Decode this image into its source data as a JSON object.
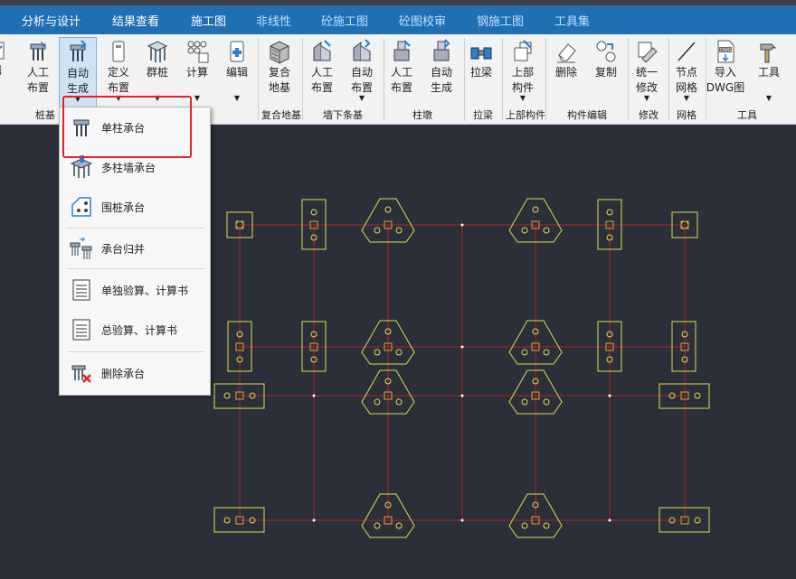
{
  "tabs": [
    "分析与设计",
    "结果查看",
    "施工图",
    "非线性",
    "砼施工图",
    "砼图校审",
    "钢施工图",
    "工具集"
  ],
  "ribbon": {
    "buttons": [
      {
        "label1": "辑",
        "label2": ""
      },
      {
        "label1": "人工",
        "label2": "布置"
      },
      {
        "label1": "自动",
        "label2": "生成"
      },
      {
        "label1": "定义",
        "label2": "布置"
      },
      {
        "label1": "群桩",
        "label2": ""
      },
      {
        "label1": "计算",
        "label2": ""
      },
      {
        "label1": "编辑",
        "label2": ""
      },
      {
        "label1": "复合",
        "label2": "地基"
      },
      {
        "label1": "人工",
        "label2": "布置"
      },
      {
        "label1": "自动",
        "label2": "布置"
      },
      {
        "label1": "人工",
        "label2": "布置"
      },
      {
        "label1": "自动",
        "label2": "生成"
      },
      {
        "label1": "拉梁",
        "label2": ""
      },
      {
        "label1": "上部",
        "label2": "构件"
      },
      {
        "label1": "删除",
        "label2": ""
      },
      {
        "label1": "复制",
        "label2": ""
      },
      {
        "label1": "统一",
        "label2": "修改"
      },
      {
        "label1": "节点",
        "label2": "网格"
      },
      {
        "label1": "导入",
        "label2": "DWG图"
      },
      {
        "label1": "工具",
        "label2": ""
      }
    ],
    "groups": [
      "桩基",
      "复合地基",
      "墙下条基",
      "柱墩",
      "拉梁",
      "上部构件",
      "构件编辑",
      "修改",
      "网格",
      "工具"
    ]
  },
  "menu": {
    "items": [
      "单柱承台",
      "多柱墙承台",
      "围桩承台",
      "承台归并",
      "单独验算、计算书",
      "总验算、计算书",
      "删除承台"
    ]
  }
}
